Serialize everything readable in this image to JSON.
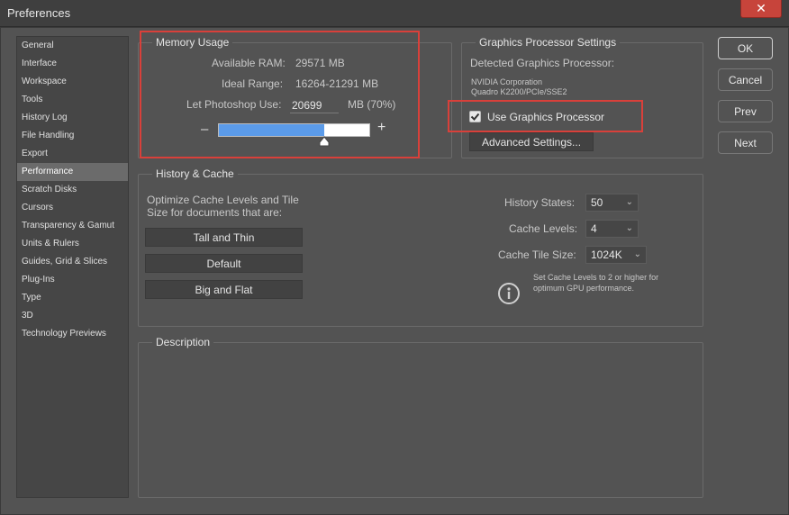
{
  "window": {
    "title": "Preferences",
    "close_glyph": "✕"
  },
  "sidebar": {
    "items": [
      {
        "label": "General"
      },
      {
        "label": "Interface"
      },
      {
        "label": "Workspace"
      },
      {
        "label": "Tools"
      },
      {
        "label": "History Log"
      },
      {
        "label": "File Handling"
      },
      {
        "label": "Export"
      },
      {
        "label": "Performance",
        "active": true
      },
      {
        "label": "Scratch Disks"
      },
      {
        "label": "Cursors"
      },
      {
        "label": "Transparency & Gamut"
      },
      {
        "label": "Units & Rulers"
      },
      {
        "label": "Guides, Grid & Slices"
      },
      {
        "label": "Plug-Ins"
      },
      {
        "label": "Type"
      },
      {
        "label": "3D"
      },
      {
        "label": "Technology Previews"
      }
    ]
  },
  "memory": {
    "title": "Memory Usage",
    "available_label": "Available RAM:",
    "available_value": "29571 MB",
    "ideal_label": "Ideal Range:",
    "ideal_value": "16264-21291 MB",
    "use_label": "Let Photoshop Use:",
    "use_value": "20699",
    "use_suffix": "MB (70%)",
    "slider_fraction": 0.7,
    "minus": "–",
    "plus": "+"
  },
  "gpu": {
    "title": "Graphics Processor Settings",
    "detected_label": "Detected Graphics Processor:",
    "vendor": "NVIDIA Corporation",
    "model": "Quadro K2200/PCIe/SSE2",
    "use_gpu_label": "Use Graphics Processor",
    "use_gpu_checked": true,
    "advanced_label": "Advanced Settings..."
  },
  "cache": {
    "title": "History & Cache",
    "optimize_line1": "Optimize Cache Levels and Tile",
    "optimize_line2": "Size for documents that are:",
    "btn_tall": "Tall and Thin",
    "btn_default": "Default",
    "btn_big": "Big and Flat",
    "history_label": "History States:",
    "history_value": "50",
    "levels_label": "Cache Levels:",
    "levels_value": "4",
    "tile_label": "Cache Tile Size:",
    "tile_value": "1024K",
    "note_line1": "Set Cache Levels to 2 or higher for",
    "note_line2": "optimum GPU performance."
  },
  "description": {
    "title": "Description"
  },
  "actions": {
    "ok": "OK",
    "cancel": "Cancel",
    "prev": "Prev",
    "next": "Next"
  },
  "colors": {
    "highlight": "#d9403a",
    "slider_fill": "#5b9be9"
  }
}
